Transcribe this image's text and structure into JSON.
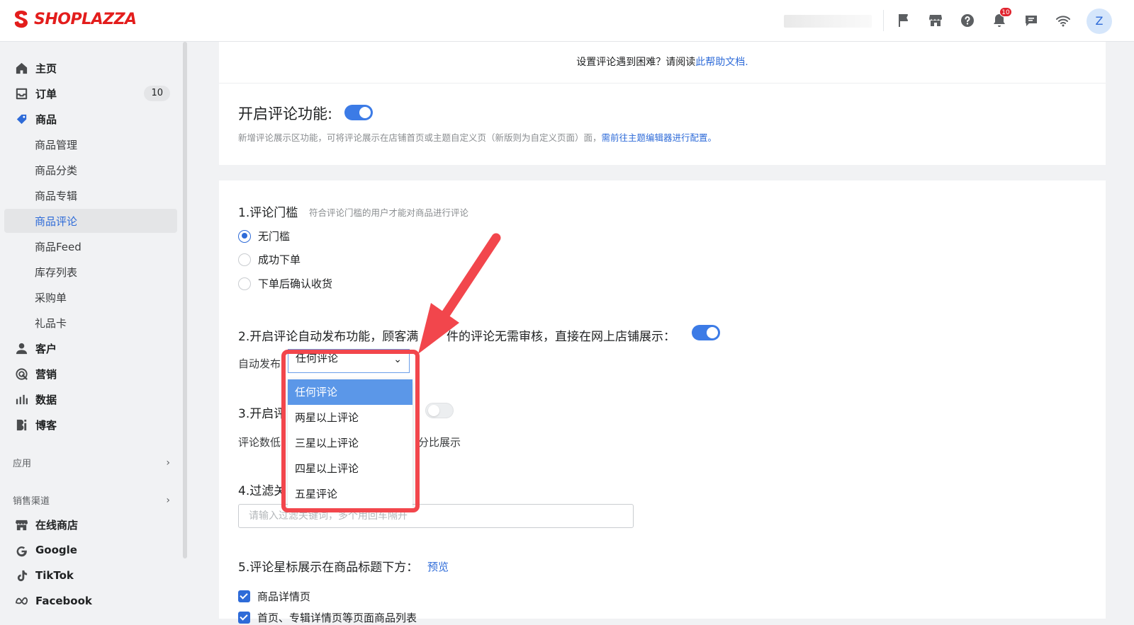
{
  "header": {
    "brand": "SHOPLAZZA",
    "notification_count": "10",
    "avatar_initial": "Z",
    "colors": {
      "brand": "#e31d1c",
      "accent": "#2e6bd8"
    },
    "icons": [
      "flag-icon",
      "store-icon",
      "help-icon",
      "bell-icon",
      "chat-icon",
      "wifi-icon"
    ]
  },
  "sidebar": {
    "items": [
      {
        "label": "主页",
        "icon": "home-icon"
      },
      {
        "label": "订单",
        "icon": "inbox-icon",
        "count": "10"
      },
      {
        "label": "商品",
        "icon": "tag-icon"
      },
      {
        "label": "商品管理"
      },
      {
        "label": "商品分类"
      },
      {
        "label": "商品专辑"
      },
      {
        "label": "商品评论"
      },
      {
        "label": "商品Feed"
      },
      {
        "label": "库存列表"
      },
      {
        "label": "采购单"
      },
      {
        "label": "礼品卡"
      },
      {
        "label": "客户",
        "icon": "person-icon"
      },
      {
        "label": "营销",
        "icon": "target-icon"
      },
      {
        "label": "数据",
        "icon": "bar-chart-icon"
      },
      {
        "label": "博客",
        "icon": "blog-icon"
      }
    ],
    "sections": {
      "apps": "应用",
      "channels": "销售渠道"
    },
    "channels": [
      {
        "label": "在线商店",
        "icon": "store-icon"
      },
      {
        "label": "Google",
        "icon": "google-icon"
      },
      {
        "label": "TikTok",
        "icon": "tiktok-icon"
      },
      {
        "label": "Facebook",
        "icon": "meta-icon"
      }
    ]
  },
  "help": {
    "text": "设置评论遇到困难？请阅读",
    "link": "此帮助文档."
  },
  "enable": {
    "title": "开启评论功能:",
    "desc": "新增评论展示区功能，可将评论展示在店铺首页或主题自定义页（新版则为自定义页面）面，",
    "link": "需前往主题编辑器进行配置。"
  },
  "threshold": {
    "title": "1.评论门槛",
    "hint": "符合评论门槛的用户才能对商品进行评论",
    "options": [
      "无门槛",
      "成功下单",
      "下单后确认收货"
    ],
    "selected": "无门槛"
  },
  "auto_publish": {
    "title_left": "2.开启评论自动发布功能，顾客满",
    "title_right": "件的评论无需审核，直接在网上店铺展示：",
    "label": "自动发布",
    "value": "任何评论",
    "options": [
      "任何评论",
      "两星以上评论",
      "三星以上评论",
      "四星以上评论",
      "五星评论"
    ]
  },
  "section3": {
    "title": "3.开启评",
    "desc_left": "评论数低",
    "desc_right": "分比展示"
  },
  "filter": {
    "title": "4.过滤关",
    "placeholder": "请输入过滤关键词，多个用回车隔开"
  },
  "stars": {
    "title": "5.评论星标展示在商品标题下方：",
    "preview": "预览",
    "checks": [
      "商品详情页",
      "首页、专辑详情页等页面商品列表"
    ]
  }
}
